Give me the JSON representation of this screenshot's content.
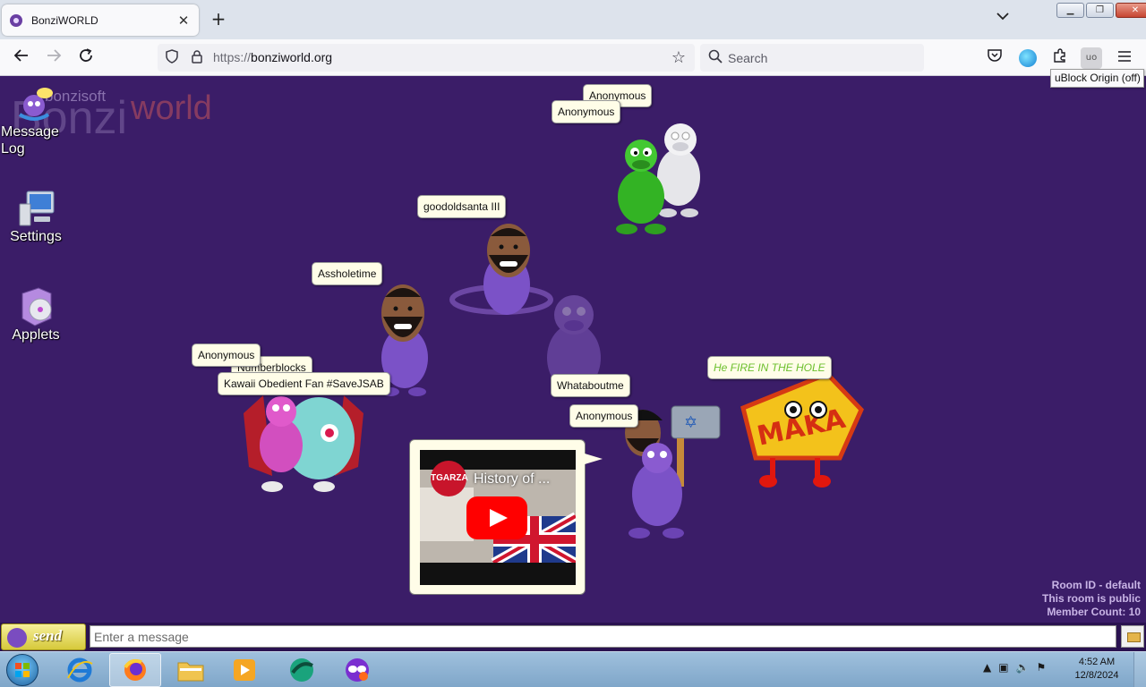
{
  "browser": {
    "tab_title": "BonziWORLD",
    "tab_close": "✕",
    "new_tab": "+",
    "url_protocol": "https://",
    "url_host": "bonziworld.org",
    "search_placeholder": "Search",
    "tooltip": "uBlock Origin (off)",
    "extension_badge": "uo"
  },
  "logo": {
    "soft": "bonzisoft",
    "main": "Bonzi",
    "world": "world"
  },
  "desktop_icons": [
    {
      "label": "Message Log"
    },
    {
      "label": "Settings"
    },
    {
      "label": "Applets"
    }
  ],
  "users": [
    {
      "name": "Anonymous"
    },
    {
      "name": "Anonymous"
    },
    {
      "name": "goodoldsanta III"
    },
    {
      "name": "Assholetime"
    },
    {
      "name": "Anonymous"
    },
    {
      "name": "Numberblocks"
    },
    {
      "name": "Kawaii Obedient Fan #SaveJSAB"
    },
    {
      "name": "Whataboutme"
    },
    {
      "name": "Anonymous"
    },
    {
      "name": "He FIRE IN THE HOLE"
    }
  ],
  "video": {
    "channel": "TGARZA",
    "title": "History of ..."
  },
  "room": {
    "id_line": "Room ID - default",
    "public_line": "This room is public",
    "member_line": "Member Count: 10"
  },
  "chat": {
    "send_label": "send",
    "input_placeholder": "Enter a message"
  },
  "taskbar": {
    "time": "4:52 AM",
    "date": "12/8/2024"
  },
  "colors": {
    "page_background": "#3b1d68",
    "nametag_background": "#fffde8",
    "green_name": "#6bbf2b"
  }
}
